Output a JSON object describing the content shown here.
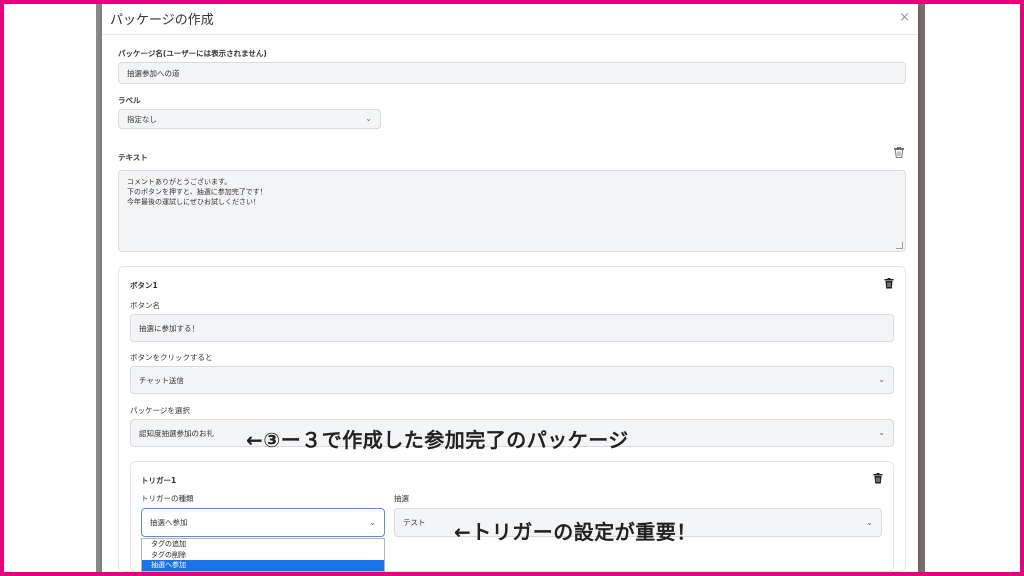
{
  "modal": {
    "title": "パッケージの作成",
    "close": "×"
  },
  "package_name": {
    "label": "パッケージ名(ユーザーには表示されません)",
    "value": "抽選参加への道"
  },
  "label_field": {
    "label": "ラベル",
    "value": "指定なし"
  },
  "text_field": {
    "label": "テキスト",
    "lines": [
      "コメントありがとうございます。",
      "下のボタンを押すと、抽選に参加完了です！",
      "今年最後の運試しにぜひお試しください！"
    ]
  },
  "button_card": {
    "title": "ボタン1",
    "name_label": "ボタン名",
    "name_value": "抽選に参加する！",
    "click_label": "ボタンをクリックすると",
    "click_value": "チャット送信",
    "package_label": "パッケージを選択",
    "package_value": "認知度抽選参加のお礼"
  },
  "trigger_card": {
    "title": "トリガー1",
    "type_label": "トリガーの種類",
    "type_value": "抽選へ参加",
    "lottery_label": "抽選",
    "lottery_value": "テスト"
  },
  "dropdown": {
    "options": [
      "タグの追加",
      "タグの削除",
      "抽選へ参加"
    ],
    "selected_index": 2
  },
  "annotations": {
    "package_note": "←③ー３で作成した参加完了のパッケージ",
    "trigger_note": "←トリガーの設定が重要！"
  },
  "colors": {
    "frame": "#e6007e",
    "selected": "#1a73e8"
  }
}
